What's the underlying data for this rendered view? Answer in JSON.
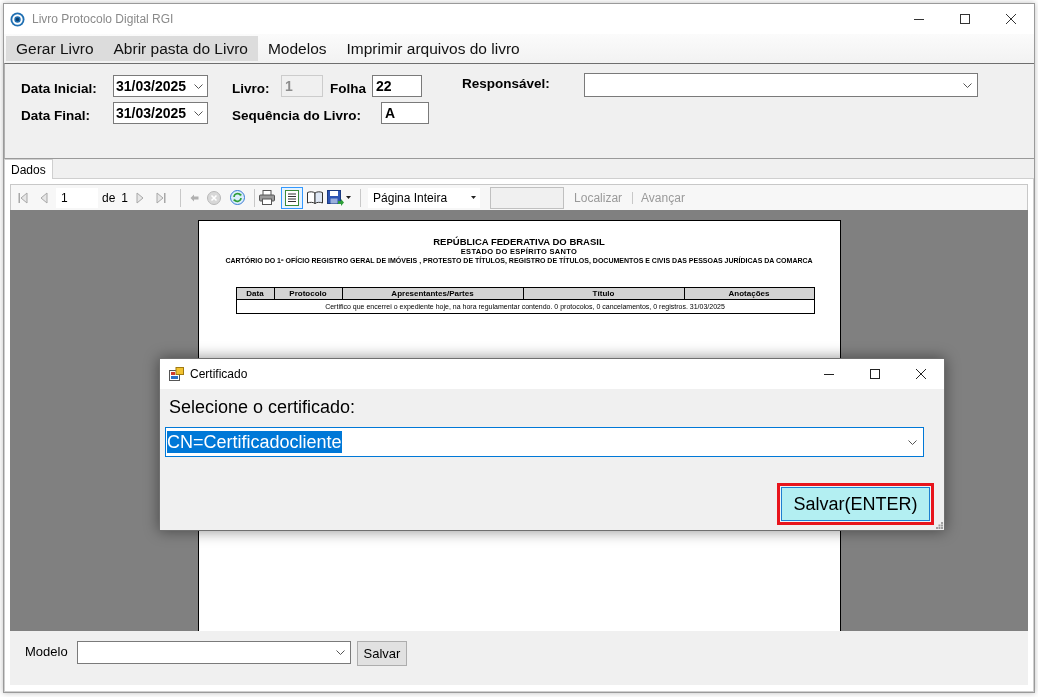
{
  "window": {
    "title": "Livro Protocolo Digital RGI"
  },
  "menu": [
    {
      "label": "Gerar Livro",
      "highlighted": true
    },
    {
      "label": "Abrir pasta do Livro",
      "highlighted": true
    },
    {
      "label": "Modelos",
      "highlighted": false
    },
    {
      "label": "Imprimir arquivos do livro",
      "highlighted": false
    }
  ],
  "form": {
    "start_date": {
      "label": "Data Inicial:",
      "value": "31/03/2025"
    },
    "end_date": {
      "label": "Data Final:",
      "value": "31/03/2025"
    },
    "book": {
      "label": "Livro:",
      "value": "1",
      "disabled": true
    },
    "sheet": {
      "label": "Folha",
      "value": "22"
    },
    "sequence": {
      "label": "Sequência do Livro:",
      "value": "A"
    },
    "responsible": {
      "label": "Responsável:"
    }
  },
  "tabs": [
    {
      "label": "Dados",
      "selected": true
    }
  ],
  "toolbar": {
    "first_page": {
      "disabled": true
    },
    "previous_page": {
      "disabled": true
    },
    "page": "1",
    "page_of": "de",
    "page_count": "1",
    "next_page": {
      "disabled": true
    },
    "last_page": {
      "disabled": true
    },
    "back": {
      "disabled": true
    },
    "stop": {
      "disabled": true
    },
    "refresh": {
      "disabled": false
    },
    "print_layout": {
      "selected": true
    },
    "zoom": "Página Inteira",
    "find_field": {
      "disabled": true
    },
    "find": {
      "label": "Localizar",
      "disabled": true
    },
    "find_next": {
      "label": "Avançar",
      "disabled": true
    }
  },
  "report": {
    "title": "REPÚBLICA FEDERATIVA DO BRASIL",
    "subtitle": "ESTADO DO ESPÍRITO SANTO",
    "office": "CARTÓRIO DO 1º OFÍCIO REGISTRO GERAL DE IMÓVEIS , PROTESTO DE TÍTULOS, REGISTRO DE TÍTULOS, DOCUMENTOS E CIVIS DAS PESSOAS JURÍDICAS DA COMARCA",
    "columns": [
      "Data",
      "Protocolo",
      "Apresentantes/Partes",
      "Título",
      "Anotações"
    ],
    "note": "Certifico que encerrei o expediente hoje, na hora regulamentar contendo. 0 protocolos, 0 cancelamentos, 0 registros. 31/03/2025"
  },
  "model_bar": {
    "label": "Modelo",
    "button": "Salvar"
  },
  "dialog": {
    "title": "Certificado",
    "prompt": "Selecione o certificado:",
    "certificate": {
      "value": "CN=Certificadocliente",
      "value_highlighted": true
    },
    "save_button": {
      "label": "Salvar(ENTER)",
      "highlighted": true
    }
  }
}
